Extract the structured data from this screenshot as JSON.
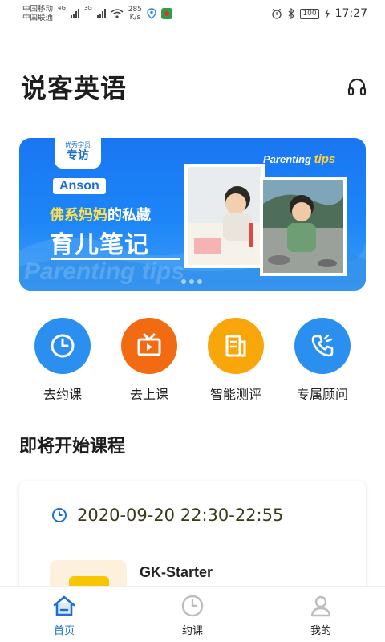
{
  "status_bar": {
    "carrier1": "中国移动",
    "carrier2": "中国联通",
    "net1": "4G",
    "net2": "3G",
    "speed_value": "285",
    "speed_unit": "K/s",
    "battery": "100",
    "time": "17:27"
  },
  "header": {
    "title": "说客英语",
    "support_icon": "headphone-icon"
  },
  "banner": {
    "tag_top": "优秀学员",
    "tag_main": "专访",
    "name_chip": "Anson",
    "line1_hl": "佛系妈妈",
    "line1_rest": "的私藏",
    "line2": "育儿笔记",
    "parenting": "Parenting",
    "tips": "tips",
    "watermark": "Parenting tips",
    "pages": 3
  },
  "quick_actions": [
    {
      "label": "去约课",
      "icon": "clock-icon",
      "color": "#2b8ff0"
    },
    {
      "label": "去上课",
      "icon": "tv-icon",
      "color": "#f26a12"
    },
    {
      "label": "智能测评",
      "icon": "document-icon",
      "color": "#f9a60a"
    },
    {
      "label": "专属顾问",
      "icon": "phone-icon",
      "color": "#2b8ff0"
    }
  ],
  "upcoming": {
    "section_title": "即将开始课程",
    "time": "2020-09-20 22:30-22:55",
    "course_name": "GK-Starter"
  },
  "tabs": [
    {
      "label": "首页",
      "icon": "home-icon",
      "active": true
    },
    {
      "label": "约课",
      "icon": "clock-icon",
      "active": false
    },
    {
      "label": "我的",
      "icon": "person-icon",
      "active": false
    }
  ],
  "colors": {
    "accent": "#1c6fd6",
    "banner_blue": "#1d86f7"
  }
}
